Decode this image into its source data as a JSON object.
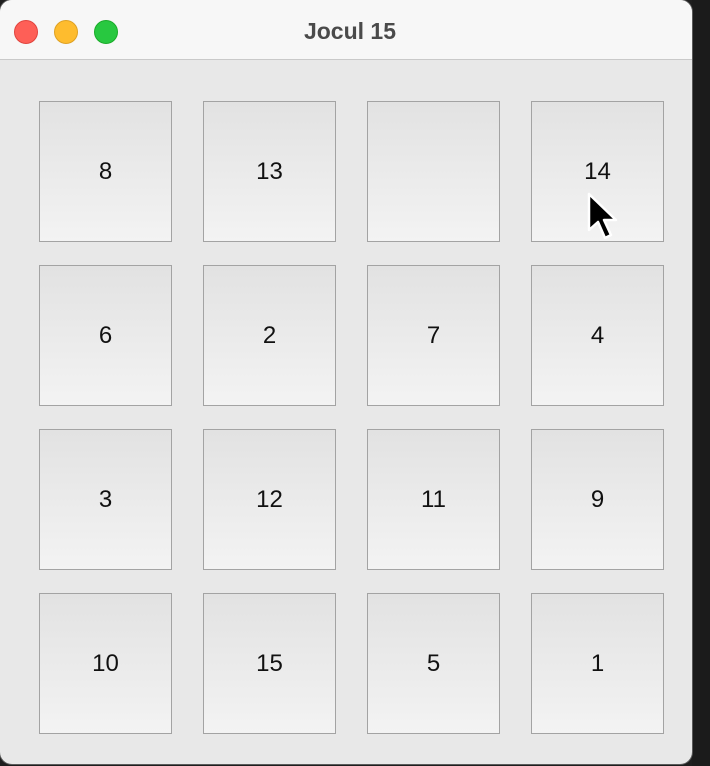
{
  "window": {
    "title": "Jocul 15"
  },
  "board": {
    "tiles": [
      "8",
      "13",
      "",
      "14",
      "6",
      "2",
      "7",
      "4",
      "3",
      "12",
      "11",
      "9",
      "10",
      "15",
      "5",
      "1"
    ]
  },
  "colors": {
    "close": "#fe5f57",
    "minimize": "#febc2e",
    "zoom": "#28c840",
    "window_bg": "#e8e8e8",
    "tile_border": "#a3a3a3"
  },
  "icons": {
    "cursor": "arrow-pointer-icon"
  }
}
